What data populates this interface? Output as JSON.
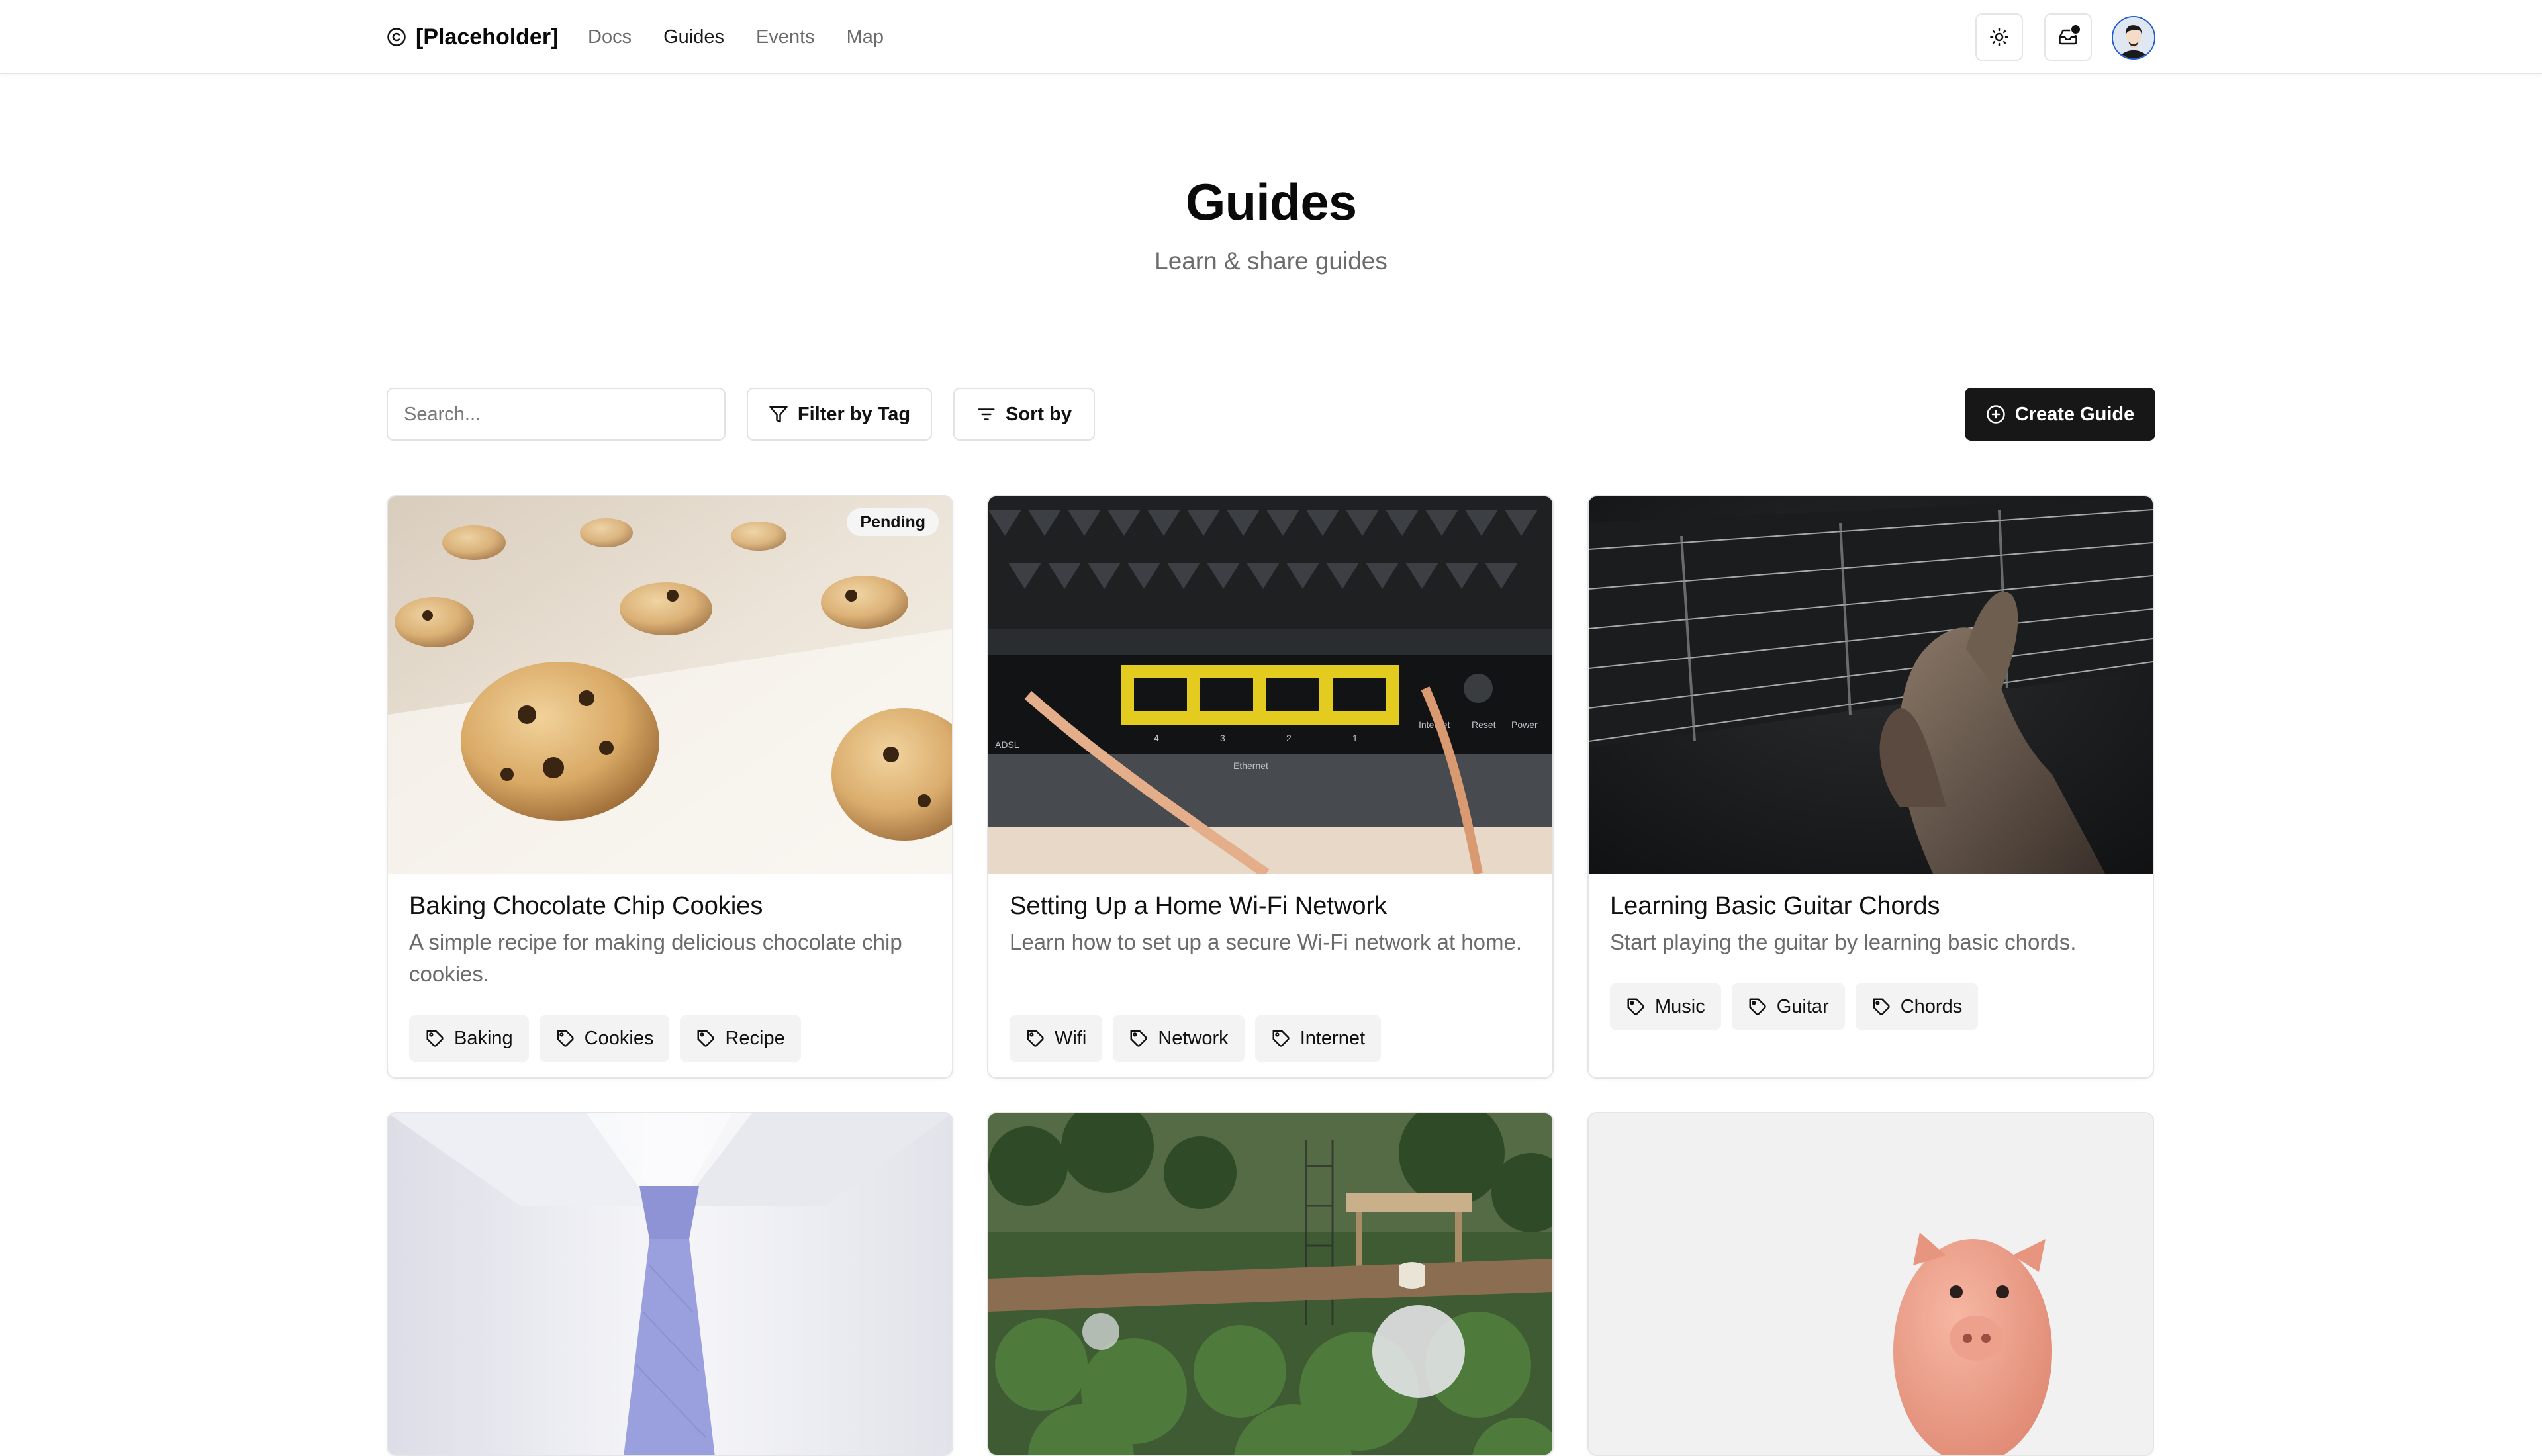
{
  "header": {
    "brand": "[Placeholder]",
    "nav": [
      {
        "label": "Docs"
      },
      {
        "label": "Guides"
      },
      {
        "label": "Events"
      },
      {
        "label": "Map"
      }
    ]
  },
  "hero": {
    "title": "Guides",
    "subtitle": "Learn & share guides"
  },
  "toolbar": {
    "search_placeholder": "Search...",
    "filter_label": "Filter by Tag",
    "sort_label": "Sort by",
    "create_label": "Create Guide"
  },
  "guides": [
    {
      "title": "Baking Chocolate Chip Cookies",
      "description": "A simple recipe for making delicious chocolate chip cookies.",
      "status": "Pending",
      "tags": [
        "Baking",
        "Cookies",
        "Recipe"
      ]
    },
    {
      "title": "Setting Up a Home Wi-Fi Network",
      "description": "Learn how to set up a secure Wi-Fi network at home.",
      "tags": [
        "Wifi",
        "Network",
        "Internet"
      ]
    },
    {
      "title": "Learning Basic Guitar Chords",
      "description": "Start playing the guitar by learning basic chords.",
      "tags": [
        "Music",
        "Guitar",
        "Chords"
      ]
    },
    {
      "title": "",
      "description": "",
      "tags": []
    },
    {
      "title": "",
      "description": "",
      "tags": []
    },
    {
      "title": "",
      "description": "",
      "tags": []
    }
  ],
  "image_labels": {
    "router_ports": [
      "ADSL",
      "4",
      "3",
      "2",
      "1",
      "Ethernet",
      "Internet",
      "Reset",
      "Power"
    ]
  },
  "colors": {
    "primary": "#171717",
    "muted_text": "#6b6b6b",
    "border": "#e5e5e5",
    "tag_bg": "#f3f3f3"
  }
}
